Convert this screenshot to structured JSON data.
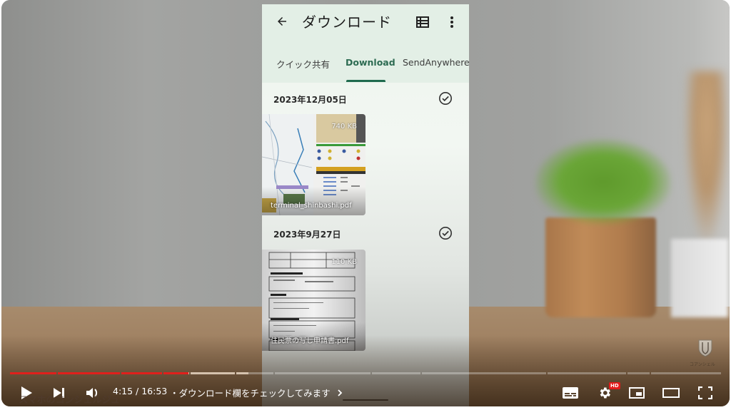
{
  "phone": {
    "app_title": "ダウンロード",
    "tabs": [
      {
        "label": "クイック共有",
        "active": false
      },
      {
        "label": "Download",
        "active": true
      },
      {
        "label": "SendAnywhere",
        "active": false
      }
    ],
    "sections": [
      {
        "date": "2023年12月05日",
        "file": {
          "name": "terminal_shinbashi.pdf",
          "size": "740 KB"
        }
      },
      {
        "date": "2023年9月27日",
        "file": {
          "name": "住民票の写し申請書.pdf",
          "size": "110 KB"
        }
      }
    ]
  },
  "player": {
    "time_current": "4:15",
    "time_total": "16:53",
    "time_display": "4:15 / 16:53",
    "chapter_title": "・ダウンロード欄をチェックしてみます",
    "progress_fraction": 0.252,
    "buffered_fraction": 0.335,
    "chapter_breaks": [
      0.066,
      0.156,
      0.215,
      0.253,
      0.317,
      0.371,
      0.508,
      0.578,
      0.755,
      0.867,
      0.901
    ],
    "hd_badge": "HD",
    "watermark": "スマホのコンシェルジュ",
    "corner_caption": "コアンシェル",
    "accent_color": "#e0201c"
  }
}
